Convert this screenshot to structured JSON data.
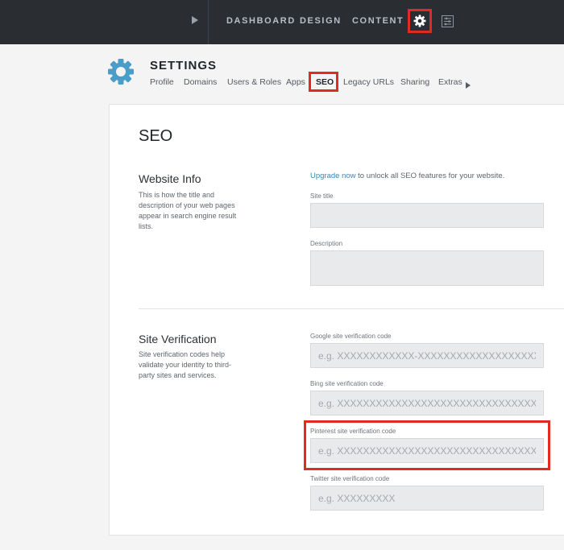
{
  "topbar": {
    "nav": [
      "DASHBOARD",
      "DESIGN",
      "CONTENT"
    ],
    "icons": [
      "play-icon",
      "gear-icon",
      "panel-icon"
    ],
    "highlight_color": "#e02b20"
  },
  "settings": {
    "title": "SETTINGS",
    "tabs": [
      "Profile",
      "Domains",
      "Users & Roles",
      "Apps",
      "SEO",
      "Legacy URLs",
      "Sharing",
      "Extras"
    ],
    "active_tab": "SEO",
    "accent_color": "#4a9cc9"
  },
  "page": {
    "title": "SEO",
    "website_info": {
      "heading": "Website Info",
      "description": "This is how the title and description of your web pages appear in search engine result lists.",
      "upgrade_link": "Upgrade now",
      "upgrade_text": " to unlock all SEO features for your website.",
      "site_title_label": "Site title",
      "site_title_value": "",
      "description_label": "Description",
      "description_value": ""
    },
    "site_verification": {
      "heading": "Site Verification",
      "description": "Site verification codes help validate your identity to third-party sites and services.",
      "google_label": "Google site verification code",
      "google_placeholder": "e.g. XXXXXXXXXXXX-XXXXXXXXXXXXXXXXXXXXXXXXXXXX",
      "bing_label": "Bing site verification code",
      "bing_placeholder": "e.g. XXXXXXXXXXXXXXXXXXXXXXXXXXXXXXXX",
      "pinterest_label": "Pinterest site verification code",
      "pinterest_placeholder": "e.g. XXXXXXXXXXXXXXXXXXXXXXXXXXXXXXXX",
      "twitter_label": "Twitter site verification code",
      "twitter_placeholder": "e.g. XXXXXXXXX"
    }
  }
}
